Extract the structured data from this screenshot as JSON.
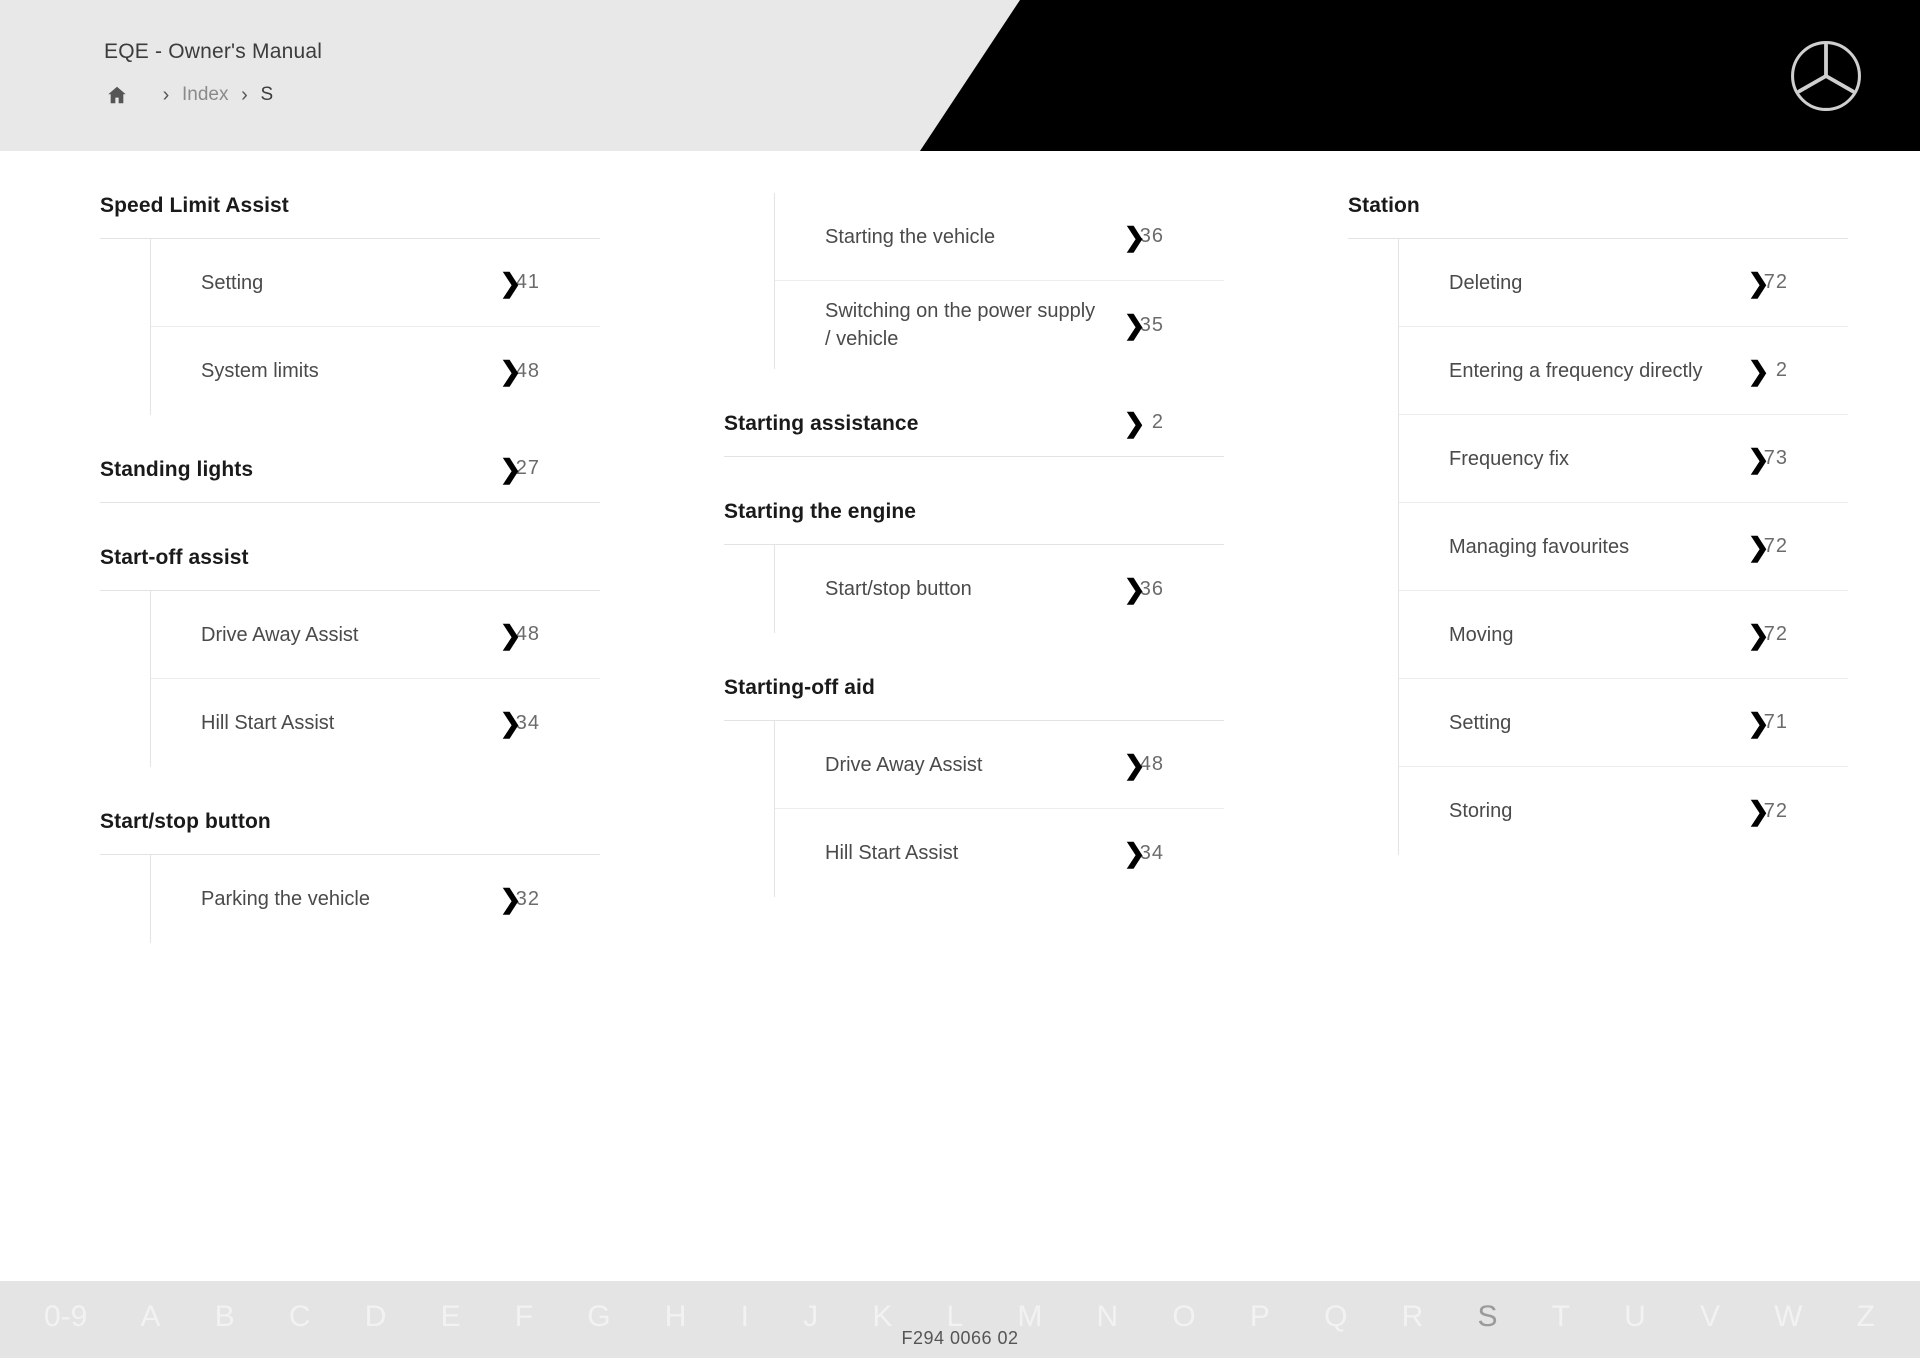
{
  "header": {
    "manual_title": "EQE - Owner's Manual",
    "breadcrumb": {
      "home_icon": "home-icon",
      "separator": "›",
      "index_label": "Index",
      "current_label": "S"
    },
    "logo": "mercedes-benz-star-logo"
  },
  "columns": [
    {
      "blocks": [
        {
          "type": "group",
          "title": "Speed Limit Assist",
          "page": "",
          "entries": [
            {
              "label": "Setting",
              "page_prefix": "4",
              "page_suffix": "1",
              "chevron": "❯"
            },
            {
              "label": "System limits",
              "page_prefix": "4",
              "page_suffix": "8",
              "chevron": "❯"
            }
          ]
        },
        {
          "type": "group",
          "title": "Standing lights",
          "page_prefix": "2",
          "page_suffix": "7",
          "chevron": "❯",
          "entries": []
        },
        {
          "type": "group",
          "title": "Start-off assist",
          "page": "",
          "entries": [
            {
              "label": "Drive Away Assist",
              "page_prefix": "4",
              "page_suffix": "8",
              "chevron": "❯"
            },
            {
              "label": "Hill Start Assist",
              "page_prefix": "3",
              "page_suffix": "4",
              "chevron": "❯"
            }
          ]
        },
        {
          "type": "group",
          "title": "Start/stop button",
          "page": "",
          "entries": [
            {
              "label": "Parking the vehicle",
              "page_prefix": "3",
              "page_suffix": "2",
              "chevron": "❯"
            }
          ]
        }
      ]
    },
    {
      "blocks": [
        {
          "type": "orphan-entries",
          "entries": [
            {
              "label": "Starting the vehicle",
              "page_prefix": "3",
              "page_suffix": "6",
              "chevron": "❯"
            },
            {
              "label": "Switching on the power supply / vehicle",
              "page_prefix": "3",
              "page_suffix": "5",
              "chevron": "❯"
            }
          ]
        },
        {
          "type": "group",
          "title": "Starting assistance",
          "page_prefix": "",
          "page_suffix": "2",
          "chevron": "❯",
          "entries": []
        },
        {
          "type": "group",
          "title": "Starting the engine",
          "page": "",
          "entries": [
            {
              "label": "Start/stop button",
              "page_prefix": "3",
              "page_suffix": "6",
              "chevron": "❯"
            }
          ]
        },
        {
          "type": "group",
          "title": "Starting-off aid",
          "page": "",
          "entries": [
            {
              "label": "Drive Away Assist",
              "page_prefix": "4",
              "page_suffix": "8",
              "chevron": "❯"
            },
            {
              "label": "Hill Start Assist",
              "page_prefix": "3",
              "page_suffix": "4",
              "chevron": "❯"
            }
          ]
        }
      ]
    },
    {
      "blocks": [
        {
          "type": "group",
          "title": "Station",
          "page": "",
          "entries": [
            {
              "label": "Deleting",
              "page_prefix": "7",
              "page_suffix": "2",
              "chevron": "❯"
            },
            {
              "label": "Entering a frequency directly",
              "page_prefix": "",
              "page_suffix": "2",
              "chevron": "❯"
            },
            {
              "label": "Frequency fix",
              "page_prefix": "7",
              "page_suffix": "3",
              "chevron": "❯"
            },
            {
              "label": "Managing favourites",
              "page_prefix": "7",
              "page_suffix": "2",
              "chevron": "❯"
            },
            {
              "label": "Moving",
              "page_prefix": "7",
              "page_suffix": "2",
              "chevron": "❯"
            },
            {
              "label": "Setting",
              "page_prefix": "7",
              "page_suffix": "1",
              "chevron": "❯"
            },
            {
              "label": "Storing",
              "page_prefix": "7",
              "page_suffix": "2",
              "chevron": "❯"
            }
          ]
        }
      ]
    }
  ],
  "alphabet_bar": {
    "active_letter": "S",
    "letters": [
      "0-9",
      "A",
      "B",
      "C",
      "D",
      "E",
      "F",
      "G",
      "H",
      "I",
      "J",
      "K",
      "L",
      "M",
      "N",
      "O",
      "P",
      "Q",
      "R",
      "S",
      "T",
      "U",
      "V",
      "W",
      "Z"
    ]
  },
  "footer": {
    "doc_code": "F294 0066 02"
  }
}
